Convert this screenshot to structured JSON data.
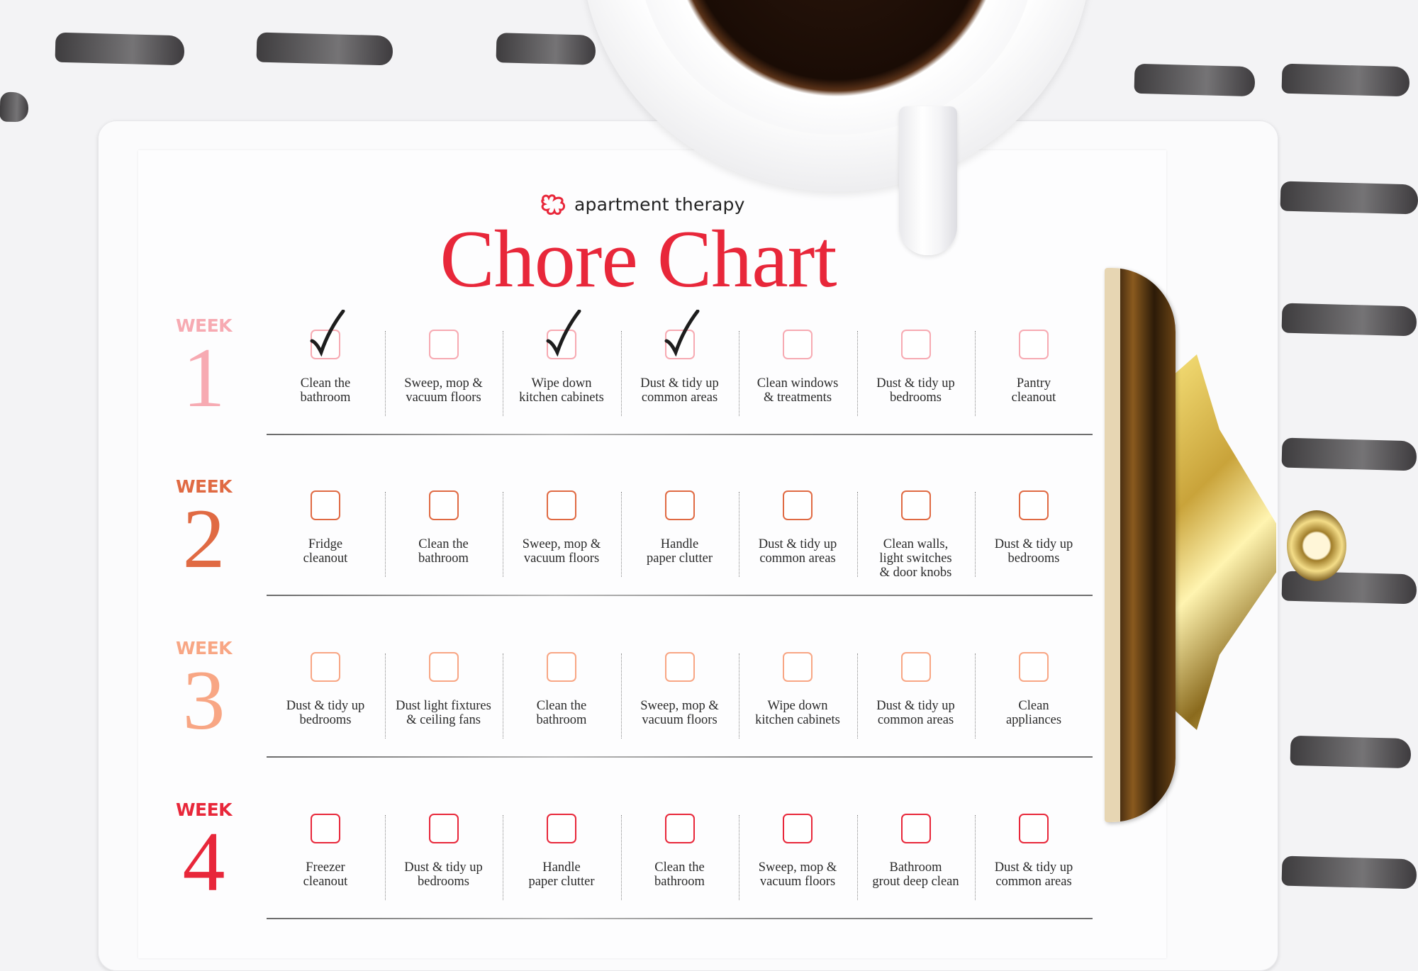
{
  "brand": {
    "logo_icon": "apartment-therapy-logo-icon",
    "name": "apartment therapy",
    "color": "#e8273a"
  },
  "title": "Chore Chart",
  "weeks": [
    {
      "label": "WEEK",
      "number": "1",
      "color": "#f7aab2",
      "tasks": [
        {
          "line1": "Clean the",
          "line2": "bathroom",
          "line3": "",
          "checked": true
        },
        {
          "line1": "Sweep, mop &",
          "line2": "vacuum floors",
          "line3": "",
          "checked": false
        },
        {
          "line1": "Wipe down",
          "line2": "kitchen cabinets",
          "line3": "",
          "checked": true
        },
        {
          "line1": "Dust & tidy up",
          "line2": "common areas",
          "line3": "",
          "checked": true
        },
        {
          "line1": "Clean windows",
          "line2": "& treatments",
          "line3": "",
          "checked": false
        },
        {
          "line1": "Dust & tidy up",
          "line2": "bedrooms",
          "line3": "",
          "checked": false
        },
        {
          "line1": "Pantry",
          "line2": "cleanout",
          "line3": "",
          "checked": false
        }
      ]
    },
    {
      "label": "WEEK",
      "number": "2",
      "color": "#e06a43",
      "tasks": [
        {
          "line1": "Fridge",
          "line2": "cleanout",
          "line3": "",
          "checked": false
        },
        {
          "line1": "Clean the",
          "line2": "bathroom",
          "line3": "",
          "checked": false
        },
        {
          "line1": "Sweep, mop &",
          "line2": "vacuum floors",
          "line3": "",
          "checked": false
        },
        {
          "line1": "Handle",
          "line2": "paper clutter",
          "line3": "",
          "checked": false
        },
        {
          "line1": "Dust & tidy up",
          "line2": "common areas",
          "line3": "",
          "checked": false
        },
        {
          "line1": "Clean walls,",
          "line2": "light switches",
          "line3": "& door knobs",
          "checked": false
        },
        {
          "line1": "Dust & tidy up",
          "line2": "bedrooms",
          "line3": "",
          "checked": false
        }
      ]
    },
    {
      "label": "WEEK",
      "number": "3",
      "color": "#f8a684",
      "tasks": [
        {
          "line1": "Dust & tidy up",
          "line2": "bedrooms",
          "line3": "",
          "checked": false
        },
        {
          "line1": "Dust light fixtures",
          "line2": "& ceiling fans",
          "line3": "",
          "checked": false
        },
        {
          "line1": "Clean the",
          "line2": "bathroom",
          "line3": "",
          "checked": false
        },
        {
          "line1": "Sweep, mop &",
          "line2": "vacuum floors",
          "line3": "",
          "checked": false
        },
        {
          "line1": "Wipe down",
          "line2": "kitchen cabinets",
          "line3": "",
          "checked": false
        },
        {
          "line1": "Dust & tidy up",
          "line2": "common areas",
          "line3": "",
          "checked": false
        },
        {
          "line1": "Clean",
          "line2": "appliances",
          "line3": "",
          "checked": false
        }
      ]
    },
    {
      "label": "WEEK",
      "number": "4",
      "color": "#e8273a",
      "tasks": [
        {
          "line1": "Freezer",
          "line2": "cleanout",
          "line3": "",
          "checked": false
        },
        {
          "line1": "Dust & tidy up",
          "line2": "bedrooms",
          "line3": "",
          "checked": false
        },
        {
          "line1": "Handle",
          "line2": "paper clutter",
          "line3": "",
          "checked": false
        },
        {
          "line1": "Clean the",
          "line2": "bathroom",
          "line3": "",
          "checked": false
        },
        {
          "line1": "Sweep, mop &",
          "line2": "vacuum floors",
          "line3": "",
          "checked": false
        },
        {
          "line1": "Bathroom",
          "line2": "grout deep clean",
          "line3": "",
          "checked": false
        },
        {
          "line1": "Dust & tidy up",
          "line2": "common areas",
          "line3": "",
          "checked": false
        }
      ]
    }
  ]
}
